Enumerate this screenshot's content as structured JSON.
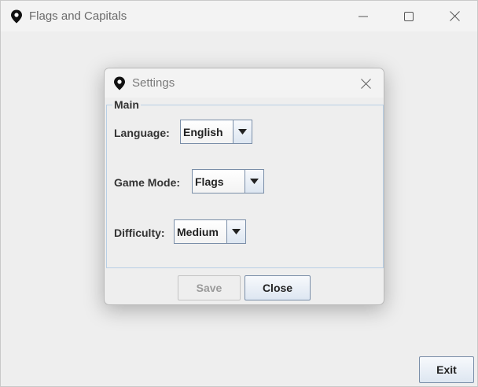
{
  "main_window": {
    "title": "Flags and Capitals",
    "icon": "location-pin-icon",
    "controls": [
      "minimize-icon",
      "maximize-icon",
      "close-icon"
    ],
    "exit_label": "Exit"
  },
  "dialog": {
    "title": "Settings",
    "icon": "location-pin-icon",
    "group_title": "Main",
    "fields": [
      {
        "label": "Language:",
        "value": "English"
      },
      {
        "label": "Game Mode:",
        "value": "Flags"
      },
      {
        "label": "Difficulty:",
        "value": "Medium"
      }
    ],
    "save_label": "Save",
    "close_label": "Close"
  }
}
